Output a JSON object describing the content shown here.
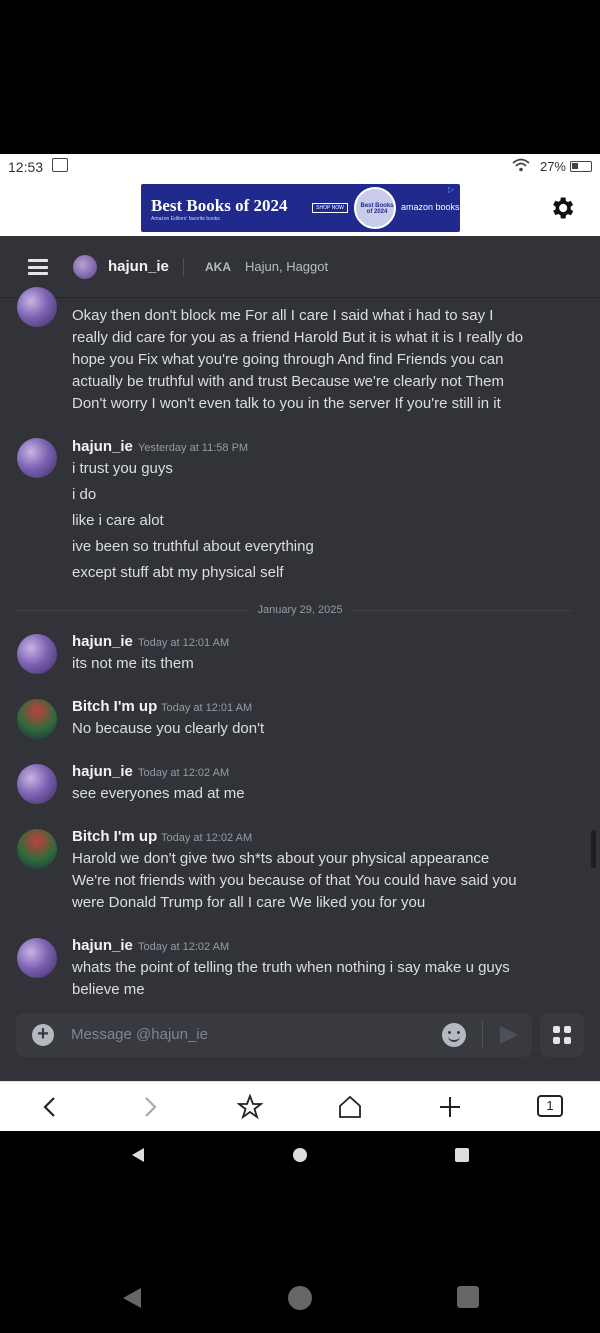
{
  "status": {
    "time": "12:53",
    "battery": "27%"
  },
  "ad": {
    "headline": "Best Books of 2024",
    "subline": "Amazon Editors' favorite books",
    "shop": "SHOP NOW",
    "seal": "Best Books of 2024",
    "brand": "amazon books"
  },
  "header": {
    "name": "hajun_ie",
    "aka_label": "AKA",
    "aka_names": "Hajun, Haggot"
  },
  "messages": {
    "m0": {
      "lines": [
        "Okay then don't block me For all I care I said what i had to say I",
        "really did care for you as a friend Harold But it is what it is I really do",
        "hope you Fix what you're going through And find Friends you can",
        "actually be truthful with and trust Because we're clearly not Them",
        "Don't worry I won't even talk to you in the server If you're still in it"
      ]
    },
    "m1": {
      "author": "hajun_ie",
      "time": "Yesterday at 11:58 PM",
      "lines": [
        "i trust you guys",
        "i do",
        "like i care alot",
        "ive been so truthful about everything",
        "except stuff abt my physical self"
      ]
    },
    "date_divider": "January 29, 2025",
    "m2": {
      "author": "hajun_ie",
      "time": "Today at 12:01 AM",
      "lines": [
        "its not me its them"
      ]
    },
    "m3": {
      "author": "Bitch I'm up",
      "time": "Today at 12:01 AM",
      "lines": [
        "No because you clearly don't"
      ]
    },
    "m4": {
      "author": "hajun_ie",
      "time": "Today at 12:02 AM",
      "lines": [
        "see everyones mad at me"
      ]
    },
    "m5": {
      "author": "Bitch I'm up",
      "time": "Today at 12:02 AM",
      "lines": [
        "Harold we don't give two sh*ts about your physical appearance",
        "We're not friends with you because of that You could have said you",
        "were Donald Trump for all I care We liked you for you"
      ]
    },
    "m6": {
      "author": "hajun_ie",
      "time": "Today at 12:02 AM",
      "lines": [
        "whats the point of telling the truth when nothing i say make u guys",
        "believe me"
      ]
    }
  },
  "composer": {
    "placeholder": "Message @hajun_ie"
  },
  "browser": {
    "tab_count": "1"
  }
}
